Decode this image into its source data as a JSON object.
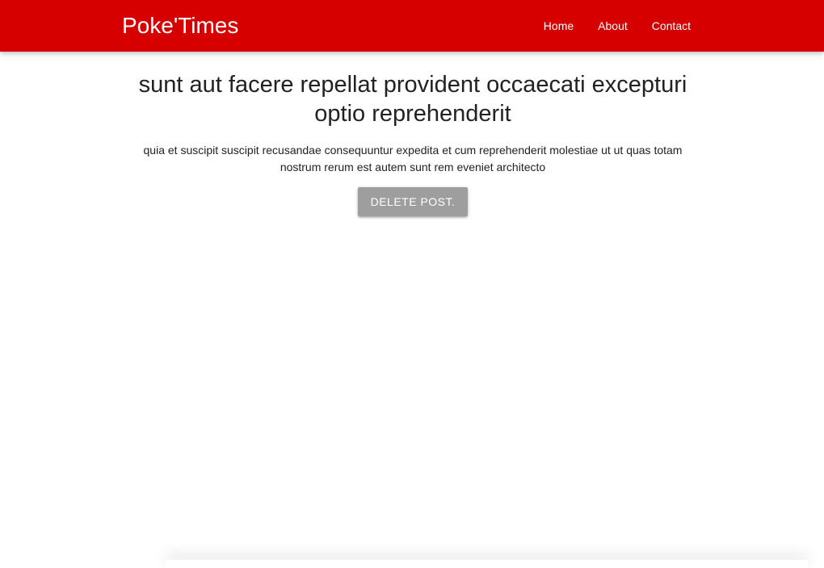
{
  "navbar": {
    "brand": "Poke'Times",
    "links": [
      {
        "label": "Home"
      },
      {
        "label": "About"
      },
      {
        "label": "Contact"
      }
    ]
  },
  "post": {
    "title": "sunt aut facere repellat provident occaecati excepturi optio reprehenderit",
    "body": "quia et suscipit suscipit recusandae consequuntur expedita et cum reprehenderit molestiae ut ut quas totam nostrum rerum est autem sunt rem eveniet architecto",
    "delete_label": "Delete Post."
  },
  "colors": {
    "navbar_bg": "#d60000",
    "button_bg": "#9e9e9e"
  }
}
